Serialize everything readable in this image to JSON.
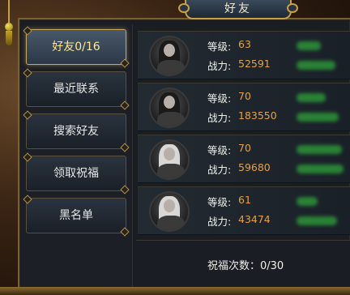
{
  "window": {
    "title": "好友"
  },
  "tabs": [
    {
      "label": "好友0/16",
      "active": true
    },
    {
      "label": "最近联系",
      "active": false
    },
    {
      "label": "搜索好友",
      "active": false
    },
    {
      "label": "领取祝福",
      "active": false
    },
    {
      "label": "黑名单",
      "active": false
    }
  ],
  "friends": [
    {
      "level_label": "等级:",
      "level": "63",
      "power_label": "战力:",
      "power": "52591",
      "avatar": "dark-hair"
    },
    {
      "level_label": "等级:",
      "level": "70",
      "power_label": "战力:",
      "power": "183550",
      "avatar": "dark-hair"
    },
    {
      "level_label": "等级:",
      "level": "70",
      "power_label": "战力:",
      "power": "59680",
      "avatar": "white-hair"
    },
    {
      "level_label": "等级:",
      "level": "61",
      "power_label": "战力:",
      "power": "43474",
      "avatar": "white-hair"
    }
  ],
  "footer": {
    "blessing_count": "祝福次数：0/30"
  },
  "colors": {
    "accent": "#e8a040",
    "active_tab_text": "#ffe890",
    "frame_gold": "#c8a048",
    "blurred_name": "#2ea23a"
  }
}
